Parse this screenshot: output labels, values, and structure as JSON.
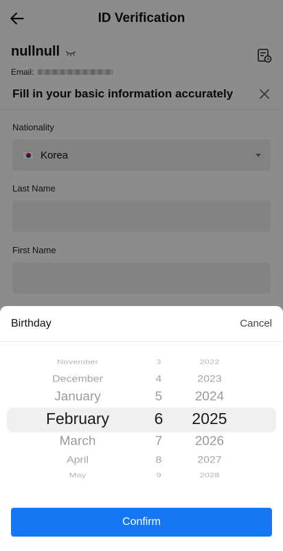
{
  "topbar": {
    "title": "ID Verification"
  },
  "user": {
    "name": "nullnull",
    "email_label": "Email:"
  },
  "form": {
    "title": "Fill in your basic information accurately",
    "nationality": {
      "label": "Nationality",
      "value": "Korea",
      "flag": "south-korea-flag"
    },
    "last_name": {
      "label": "Last Name",
      "value": ""
    },
    "first_name": {
      "label": "First Name",
      "value": ""
    }
  },
  "picker": {
    "title": "Birthday",
    "cancel_label": "Cancel",
    "confirm_label": "Confirm",
    "months": [
      "November",
      "December",
      "January",
      "February",
      "March",
      "April",
      "May"
    ],
    "days": [
      "3",
      "4",
      "5",
      "6",
      "7",
      "8",
      "9"
    ],
    "years": [
      "2022",
      "2023",
      "2024",
      "2025",
      "2026",
      "2027",
      "2028"
    ],
    "selected": {
      "month": "February",
      "day": "6",
      "year": "2025"
    }
  },
  "colors": {
    "accent": "#1677f3",
    "overlay": "rgba(0,0,0,0.45)"
  }
}
